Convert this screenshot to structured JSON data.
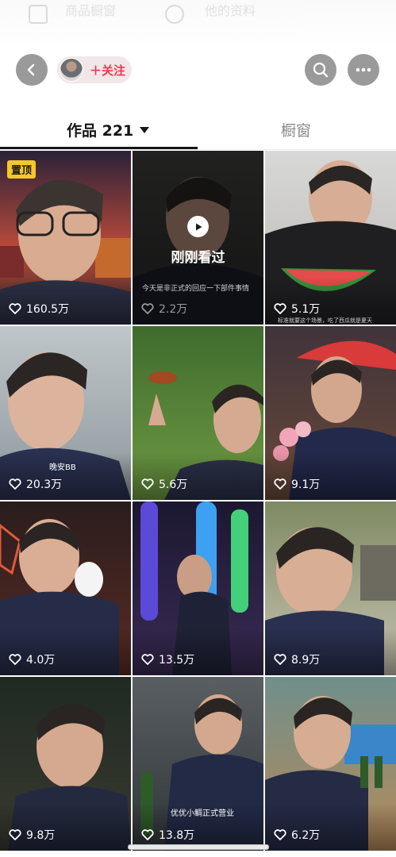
{
  "header": {
    "faded_left_text": "商品橱窗",
    "faded_right_text": "他的资料"
  },
  "topbar": {
    "follow_label": "＋关注",
    "back_icon": "chevron-left-icon",
    "search_icon": "search-icon",
    "more_icon": "more-horizontal-icon"
  },
  "tabs": {
    "works_label": "作品 221",
    "window_label": "橱窗"
  },
  "videos": [
    {
      "likes": "160.5万",
      "badge": "置顶"
    },
    {
      "likes": "2.2万",
      "overlay_label": "刚刚看过",
      "caption": "今天是非正式的回应一下部件事情"
    },
    {
      "likes": "5.1万",
      "caption": "标准就要这个场景，吃了西瓜就是夏天"
    },
    {
      "likes": "20.3万",
      "caption": "晚安BB"
    },
    {
      "likes": "5.6万"
    },
    {
      "likes": "9.1万"
    },
    {
      "likes": "4.0万"
    },
    {
      "likes": "13.5万"
    },
    {
      "likes": "8.9万"
    },
    {
      "likes": "9.8万"
    },
    {
      "likes": "13.8万",
      "caption": "优优小鲷正式营业"
    },
    {
      "likes": "6.2万"
    }
  ],
  "colors": {
    "accent": "#e8394f",
    "badge": "#f7c72a",
    "button_gray": "#9a9a9a"
  }
}
